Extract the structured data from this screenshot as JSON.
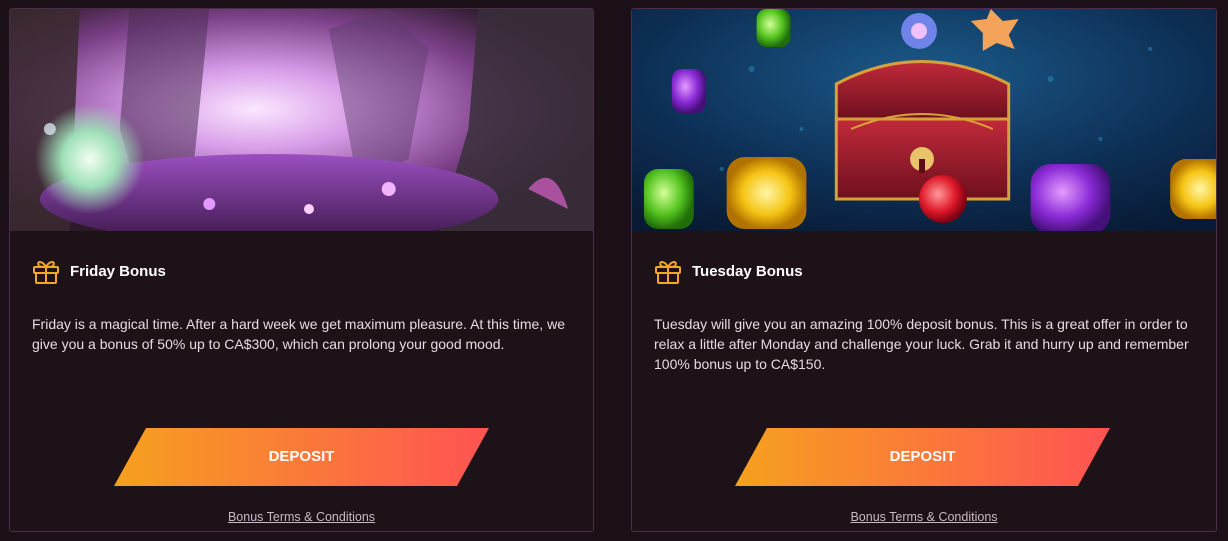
{
  "cards": [
    {
      "title": "Friday Bonus",
      "description": "Friday is a magical time. After a hard week we get maximum pleasure. At this time, we give you a bonus of 50% up to CA$300, which can prolong your good mood.",
      "button_label": "DEPOSIT",
      "terms_label": "Bonus Terms & Conditions",
      "banner_icon": "magic-forest-image"
    },
    {
      "title": "Tuesday Bonus",
      "description": "Tuesday will give you an amazing 100% deposit bonus. This is a great offer in order to relax a little after Monday and challenge your luck. Grab it and hurry up and remember 100% bonus up to CA$150.",
      "button_label": "DEPOSIT",
      "terms_label": "Bonus Terms & Conditions",
      "banner_icon": "treasure-chest-gems-image"
    }
  ],
  "colors": {
    "background": "#1b1018",
    "card": "#1e1219",
    "card_border": "#4a2e45",
    "accent_start": "#f6a11e",
    "accent_end": "#ff5353",
    "icon": "#f5a623"
  },
  "icons": {
    "gift": "gift-icon"
  }
}
